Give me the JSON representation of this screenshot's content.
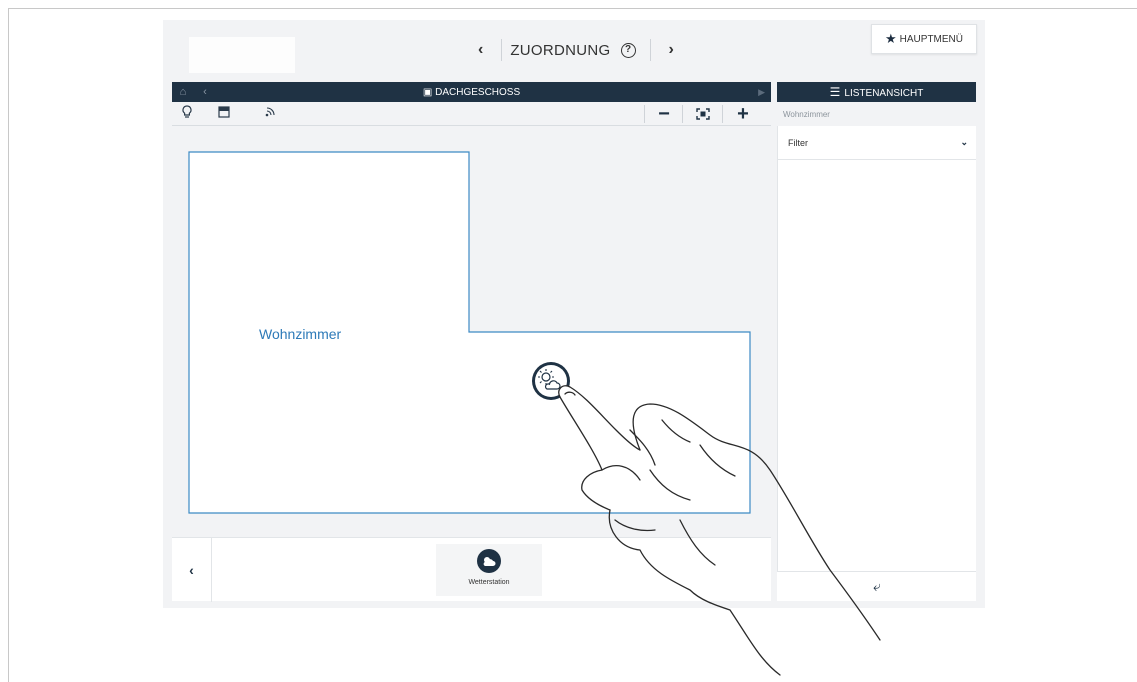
{
  "header": {
    "title": "ZUORDNUNG",
    "prev_icon": "chevron-left-icon",
    "next_icon": "chevron-right-icon",
    "help_glyph": "?",
    "main_menu_label": "HAUPTMENÜ",
    "main_menu_icon": "star-icon"
  },
  "floor_panel": {
    "title": "DACHGESCHOSS",
    "home_icon": "home-icon",
    "back_icon": "chevron-left-icon",
    "floor_icon": "floor-plan-icon",
    "toolbar": {
      "tools": [
        "lightbulb-icon",
        "blind-icon",
        "wireless-icon"
      ],
      "zoom_out": "−",
      "zoom_in": "+",
      "fit_icon": "fit-screen-icon"
    },
    "room_label": "Wohnzimmer"
  },
  "device_bar": {
    "device_label": "Wetterstation",
    "device_icon": "weather-icon"
  },
  "list_panel": {
    "title": "LISTENANSICHT",
    "title_icon": "list-icon",
    "room": "Wohnzimmer",
    "filter_label": "Filter",
    "back_icon": "reply-arrow-icon"
  },
  "colors": {
    "header_bg": "#1f3244",
    "accent_blue": "#2d7ab8",
    "panel_bg": "#f2f3f5"
  }
}
